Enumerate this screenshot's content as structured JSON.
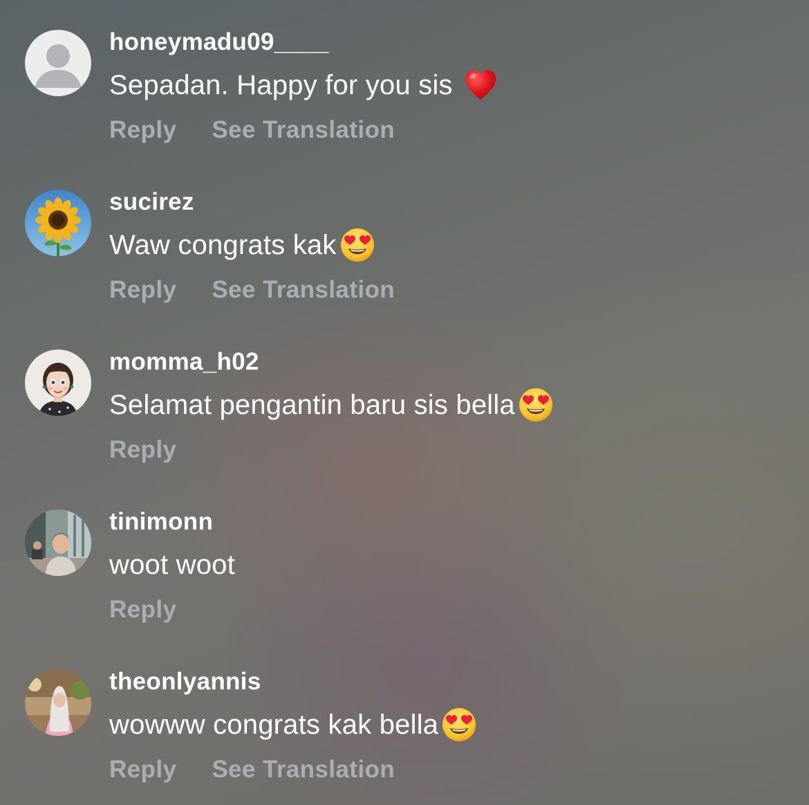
{
  "comments": [
    {
      "username": "honeymadu09____",
      "text": "Sepadan. Happy for you sis",
      "emoji": "red-heart",
      "avatar": "default-avatar-icon",
      "actions": [
        "Reply",
        "See Translation"
      ]
    },
    {
      "username": "sucirez",
      "text": "Waw congrats kak",
      "emoji": "heart-eyes",
      "avatar": "sunflower-avatar",
      "actions": [
        "Reply",
        "See Translation"
      ]
    },
    {
      "username": "momma_h02",
      "text": "Selamat pengantin baru sis bella",
      "emoji": "heart-eyes",
      "avatar": "cartoon-woman-avatar",
      "actions": [
        "Reply"
      ]
    },
    {
      "username": "tinimonn",
      "text": "woot woot",
      "emoji": "",
      "avatar": "photo-avatar",
      "actions": [
        "Reply"
      ]
    },
    {
      "username": "theonlyannis",
      "text": "wowww congrats kak bella",
      "emoji": "heart-eyes",
      "avatar": "photo-avatar",
      "actions": [
        "Reply",
        "See Translation"
      ]
    }
  ],
  "colors": {
    "username": "#ffffff",
    "comment_text": "#ffffff",
    "action_text": "#a9aeb4",
    "default_avatar_bg": "#ececec",
    "default_avatar_figure": "#b4b4b8"
  }
}
